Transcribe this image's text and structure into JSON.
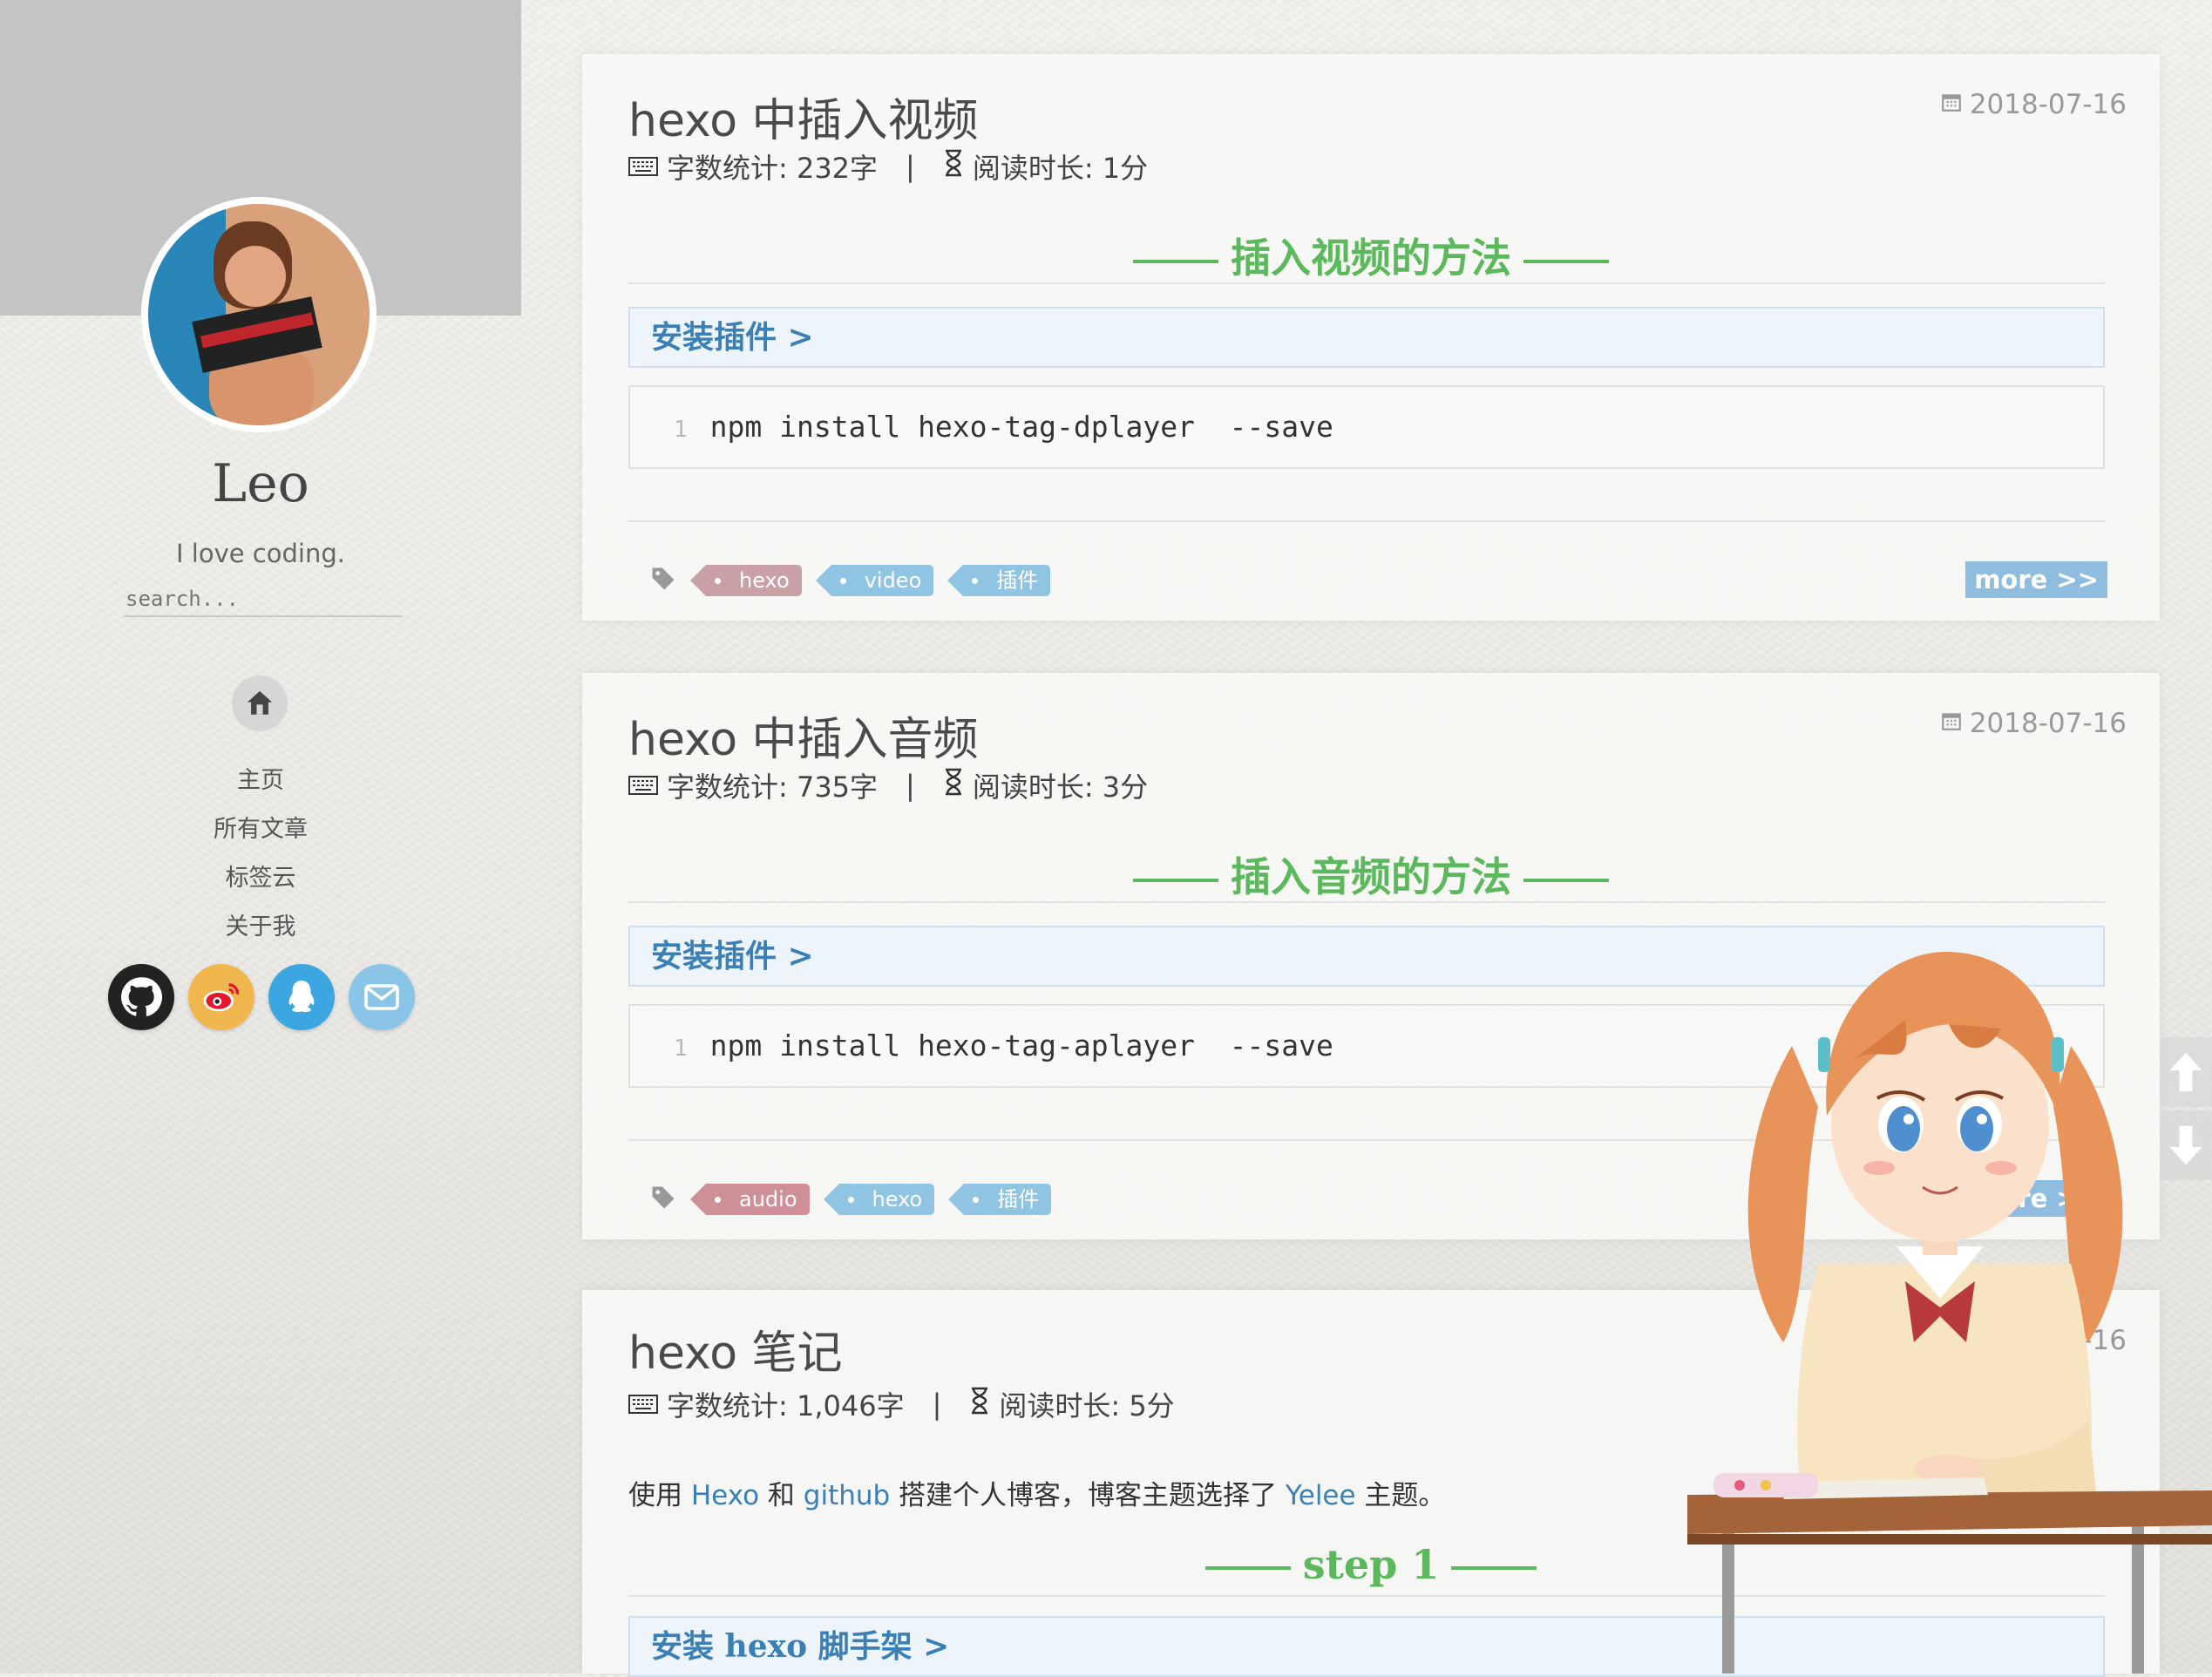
{
  "sidebar": {
    "name": "Leo",
    "motto": "I love coding.",
    "search_placeholder": "search...",
    "nav": [
      "主页",
      "所有文章",
      "标签云",
      "关于我"
    ],
    "social_icons": [
      "github-icon",
      "weibo-icon",
      "qq-icon",
      "mail-icon"
    ]
  },
  "posts": [
    {
      "title": "hexo 中插入视频",
      "date": "2018-07-16",
      "word_count": "字数统计: 232字",
      "read_time": "阅读时长: 1分",
      "heading": "插入视频的方法",
      "subheading": "安装插件 >",
      "code_line_no": "1",
      "code": "npm install hexo-tag-dplayer  --save",
      "tags": [
        "hexo",
        "video",
        "插件"
      ],
      "more": "more >>"
    },
    {
      "title": "hexo 中插入音频",
      "date": "2018-07-16",
      "word_count": "字数统计: 735字",
      "read_time": "阅读时长: 3分",
      "heading": "插入音频的方法",
      "subheading": "安装插件 >",
      "code_line_no": "1",
      "code": "npm install hexo-tag-aplayer  --save",
      "tags": [
        "audio",
        "hexo",
        "插件"
      ],
      "more": "more >>"
    },
    {
      "title": "hexo 笔记",
      "date": "2018-07-16",
      "word_count": "字数统计: 1,046字",
      "read_time": "阅读时长: 5分",
      "intro": {
        "t1": "使用 ",
        "link1": "Hexo",
        "t2": " 和 ",
        "link2": "github",
        "t3": " 搭建个人博客，博客主题选择了 ",
        "link3": "Yelee",
        "t4": " 主题。"
      },
      "heading": "step 1",
      "subheading": "安装 hexo 脚手架 >"
    }
  ],
  "colors": {
    "accent_green": "#5cb85c",
    "link_blue": "#3a7fb5",
    "more_button": "#8fbde0",
    "tag_pink": "#c9a0a6",
    "tag_blue": "#8fc4e2"
  }
}
